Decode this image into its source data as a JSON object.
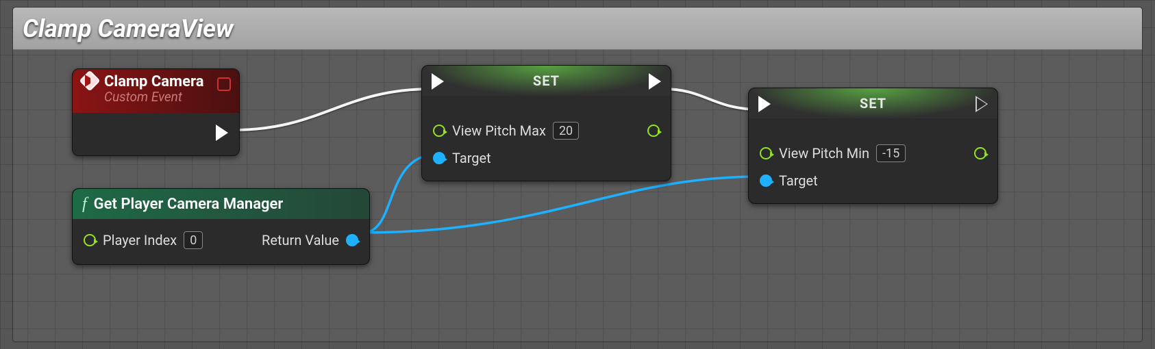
{
  "comment": {
    "title": "Clamp CameraView"
  },
  "event": {
    "title": "Clamp Camera",
    "subtitle": "Custom Event"
  },
  "func": {
    "title": "Get Player Camera Manager",
    "player_index_label": "Player Index",
    "player_index_value": "0",
    "return_label": "Return Value"
  },
  "set1": {
    "title": "SET",
    "param_label": "View Pitch Max",
    "param_value": "20",
    "target_label": "Target"
  },
  "set2": {
    "title": "SET",
    "param_label": "View Pitch Min",
    "param_value": "-15",
    "target_label": "Target"
  }
}
